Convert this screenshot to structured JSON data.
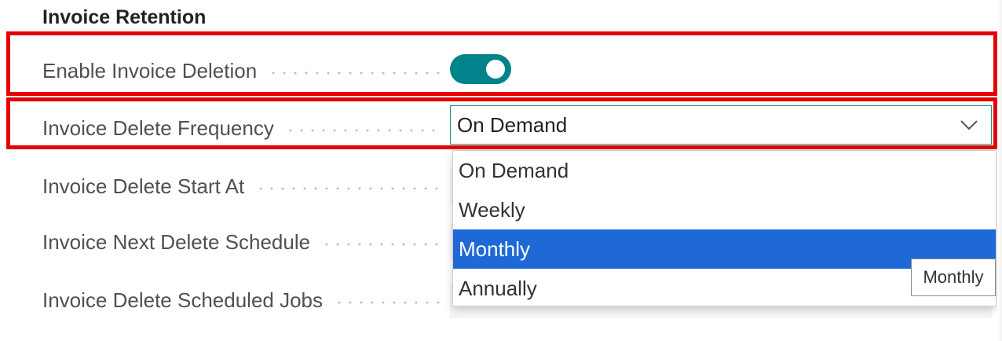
{
  "section": {
    "title": "Invoice Retention"
  },
  "fields": {
    "enable_deletion": {
      "label": "Enable Invoice Deletion",
      "toggle_on": true
    },
    "delete_frequency": {
      "label": "Invoice Delete Frequency",
      "value": "On Demand"
    },
    "start_at": {
      "label": "Invoice Delete Start At"
    },
    "next_schedule": {
      "label": "Invoice Next Delete Schedule"
    },
    "scheduled_jobs": {
      "label": "Invoice Delete Scheduled Jobs"
    }
  },
  "dropdown": {
    "options": [
      "On Demand",
      "Weekly",
      "Monthly",
      "Annually"
    ],
    "highlighted": "Monthly"
  },
  "tooltip": {
    "text": "Monthly"
  },
  "colors": {
    "toggle": "#00838a",
    "selected_option": "#1e69d6",
    "highlight_box": "#e60000"
  },
  "icons": {
    "select_arrow": "chevron-down-icon"
  }
}
